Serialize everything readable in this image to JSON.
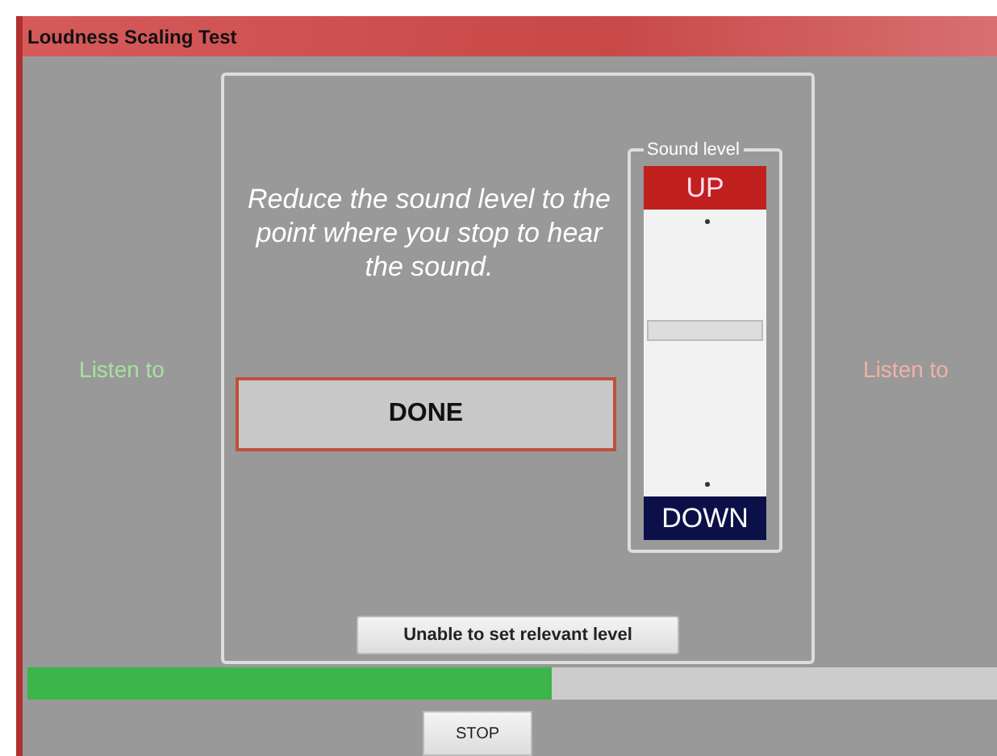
{
  "window": {
    "title": "Loudness Scaling Test"
  },
  "left_label": "Listen to",
  "right_label": "Listen to",
  "instruction": "Reduce the sound level to the point where you stop to hear the sound.",
  "done_button": "DONE",
  "sound_level": {
    "legend": "Sound level",
    "up_button": "UP",
    "down_button": "DOWN",
    "level": 0.58
  },
  "unable_button": "Unable to set relevant level",
  "progress": {
    "level": 0.54
  },
  "stop_button": "STOP"
}
